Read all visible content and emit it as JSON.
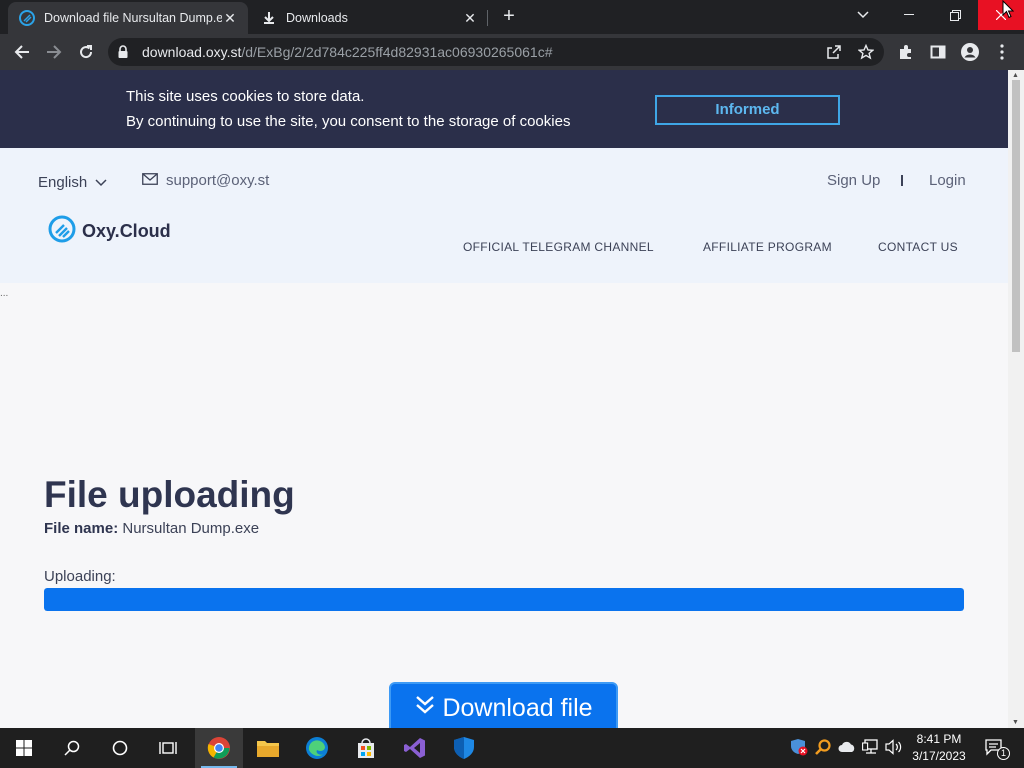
{
  "browser": {
    "tabs": [
      {
        "title": "Download file Nursultan Dump.e",
        "active": true
      },
      {
        "title": "Downloads",
        "active": false
      }
    ],
    "url_host": "download.oxy.st",
    "url_path": "/d/ExBg/2/2d784c225ff4d82931ac06930265061c#"
  },
  "cookie": {
    "line1": "This site uses cookies to store data.",
    "line2": "By continuing to use the site, you consent to the storage of cookies",
    "button": "Informed"
  },
  "header": {
    "language": "English",
    "email": "support@oxy.st",
    "signup": "Sign Up",
    "login": "Login",
    "brand": "Oxy.Cloud",
    "nav": [
      "OFFICIAL TELEGRAM CHANNEL",
      "AFFILIATE PROGRAM",
      "CONTACT US"
    ]
  },
  "main": {
    "heading": "File uploading",
    "file_label": "File name:",
    "file_name": "Nursultan Dump.exe",
    "uploading_label": "Uploading:",
    "progress_fraction": 1.0,
    "download_button": "Download file",
    "dots": "..."
  },
  "taskbar": {
    "time": "8:41 PM",
    "date": "3/17/2023",
    "notification_count": "1"
  },
  "colors": {
    "accent": "#0a73ee",
    "cookie_bar": "#2b2f4a",
    "heading": "#2f3550"
  }
}
